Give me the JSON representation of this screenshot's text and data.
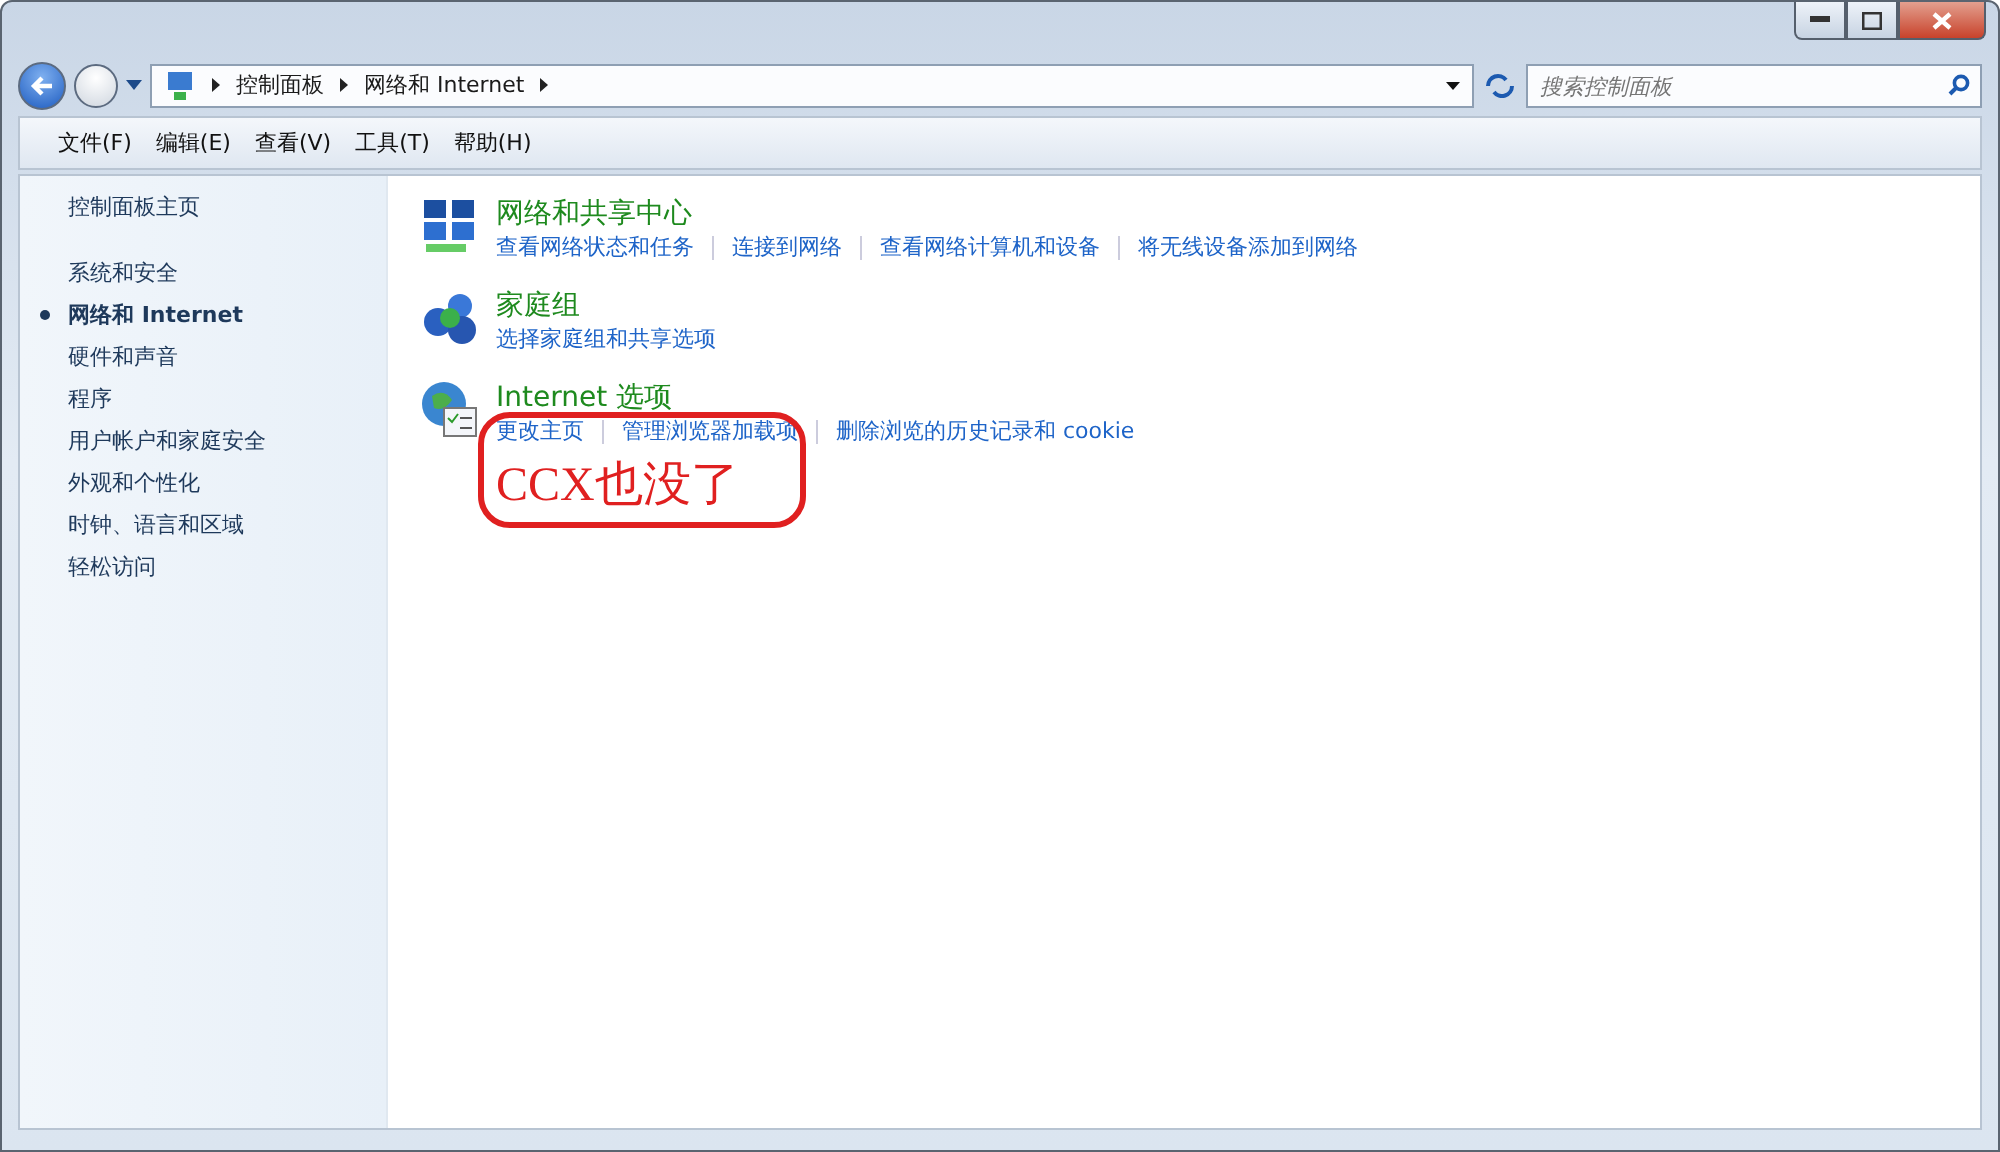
{
  "window": {
    "controls": [
      {
        "kind": "minimize"
      },
      {
        "kind": "maximize"
      },
      {
        "kind": "close"
      }
    ]
  },
  "address_bar": {
    "breadcrumbs": [
      "控制面板",
      "网络和 Internet"
    ],
    "search": {
      "placeholder": "搜索控制面板"
    }
  },
  "menu_bar": [
    "文件(F)",
    "编辑(E)",
    "查看(V)",
    "工具(T)",
    "帮助(H)"
  ],
  "sidebar": {
    "home": "控制面板主页",
    "items": [
      {
        "label": "系统和安全",
        "selected": false
      },
      {
        "label": "网络和 Internet",
        "selected": true
      },
      {
        "label": "硬件和声音",
        "selected": false
      },
      {
        "label": "程序",
        "selected": false
      },
      {
        "label": "用户帐户和家庭安全",
        "selected": false
      },
      {
        "label": "外观和个性化",
        "selected": false
      },
      {
        "label": "时钟、语言和区域",
        "selected": false
      },
      {
        "label": "轻松访问",
        "selected": false
      }
    ]
  },
  "categories": [
    {
      "kind": "network",
      "title": "网络和共享中心",
      "links": [
        "查看网络状态和任务",
        "连接到网络",
        "查看网络计算机和设备",
        "将无线设备添加到网络"
      ]
    },
    {
      "kind": "homegroup",
      "title": "家庭组",
      "links": [
        "选择家庭组和共享选项"
      ]
    },
    {
      "kind": "internet",
      "title": "Internet 选项",
      "links": [
        "更改主页",
        "管理浏览器加载项",
        "删除浏览的历史记录和 cookie"
      ]
    }
  ],
  "annotation": {
    "text": "CCX也没了"
  }
}
